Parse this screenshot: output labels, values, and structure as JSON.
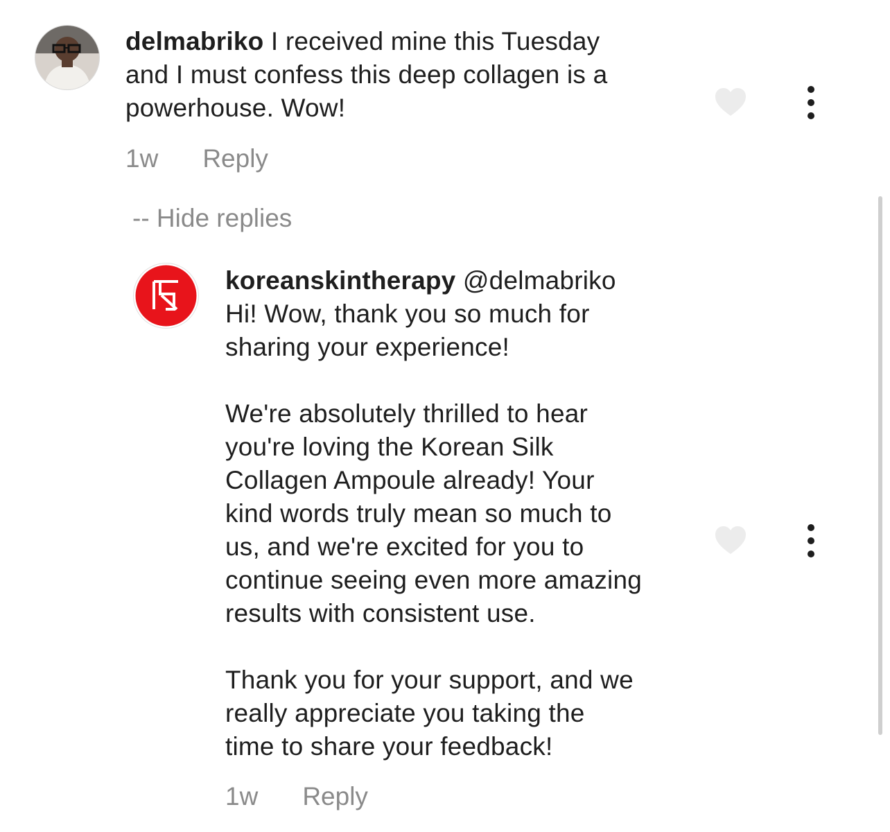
{
  "comments": [
    {
      "username": "delmabriko",
      "text": " I received mine this Tuesday\nand I must confess this deep collagen is a\npowerhouse. Wow!",
      "time": "1w",
      "reply_label": "Reply",
      "avatar_icon": "user-photo-avatar"
    }
  ],
  "hide_replies_label": "-- Hide replies",
  "replies": [
    {
      "username": "koreanskintherapy",
      "mention": " @delmabriko",
      "text": "\nHi! Wow, thank you so much for\nsharing your experience!\n\nWe're absolutely thrilled to hear\nyou're loving the Korean Silk\nCollagen Ampoule already! Your\nkind words truly mean so much to\nus, and we're excited for you to\ncontinue seeing even more amazing\nresults with consistent use.\n\nThank you for your support, and we\nreally appreciate you taking the\ntime to share your feedback!",
      "time": "1w",
      "reply_label": "Reply",
      "avatar_icon": "brand-logo-avatar"
    }
  ],
  "icons": {
    "like": "heart-icon",
    "more": "more-options-icon"
  },
  "colors": {
    "brand_red": "#e8141b",
    "heart_fill": "#ececec",
    "muted_text": "#8a8a8a"
  }
}
